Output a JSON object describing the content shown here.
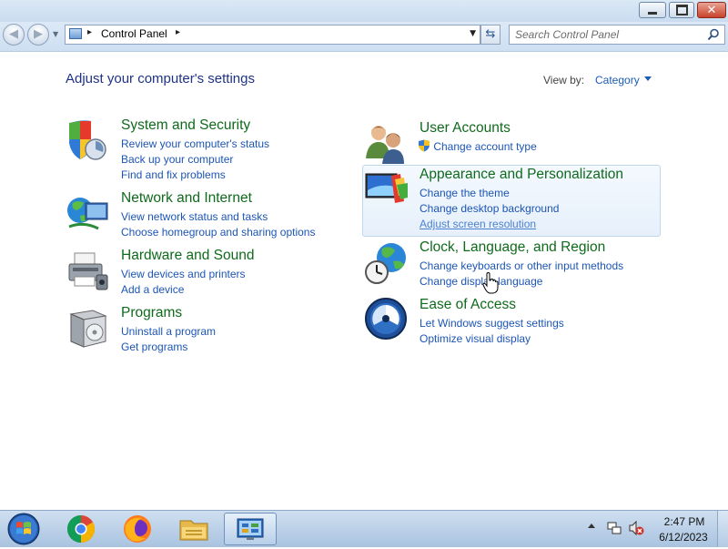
{
  "window": {
    "minimize_icon": "minimize-icon",
    "maximize_icon": "restore-icon",
    "close_icon": "close-icon",
    "close_glyph": "✕"
  },
  "nav": {
    "back_glyph": "◀",
    "forward_glyph": "▶",
    "breadcrumb": "Control Panel",
    "separator": "▸",
    "refresh_glyph": "⇆",
    "search_placeholder": "Search Control Panel"
  },
  "header": {
    "title": "Adjust your computer's settings",
    "view_by_label": "View by:",
    "view_by_value": "Category"
  },
  "categories": [
    {
      "title": "System and Security",
      "icon": "shield-icon",
      "links": [
        "Review your computer's status",
        "Back up your computer",
        "Find and fix problems"
      ]
    },
    {
      "title": "Network and Internet",
      "icon": "network-globe-icon",
      "links": [
        "View network status and tasks",
        "Choose homegroup and sharing options"
      ]
    },
    {
      "title": "Hardware and Sound",
      "icon": "printer-icon",
      "links": [
        "View devices and printers",
        "Add a device"
      ]
    },
    {
      "title": "Programs",
      "icon": "programs-box-icon",
      "links": [
        "Uninstall a program",
        "Get programs"
      ]
    },
    {
      "title": "User Accounts",
      "icon": "users-icon",
      "links": [
        "Change account type"
      ],
      "link_icon": "uac-shield-icon"
    },
    {
      "title": "Appearance and Personalization",
      "icon": "monitor-palette-icon",
      "links": [
        "Change the theme",
        "Change desktop background",
        "Adjust screen resolution"
      ]
    },
    {
      "title": "Clock, Language, and Region",
      "icon": "clock-globe-icon",
      "links": [
        "Change keyboards or other input methods",
        "Change display language"
      ]
    },
    {
      "title": "Ease of Access",
      "icon": "ease-of-access-icon",
      "links": [
        "Let Windows suggest settings",
        "Optimize visual display"
      ]
    }
  ],
  "taskbar": {
    "items": [
      "start-orb-icon",
      "chrome-icon",
      "firefox-icon",
      "file-explorer-icon",
      "control-panel-icon"
    ],
    "active_item": "control-panel-icon",
    "clock_time": "2:47 PM",
    "clock_date": "6/12/2023"
  },
  "colors": {
    "category_title": "#0f6a1c",
    "link": "#1c55b5",
    "page_title": "#1e3287"
  }
}
